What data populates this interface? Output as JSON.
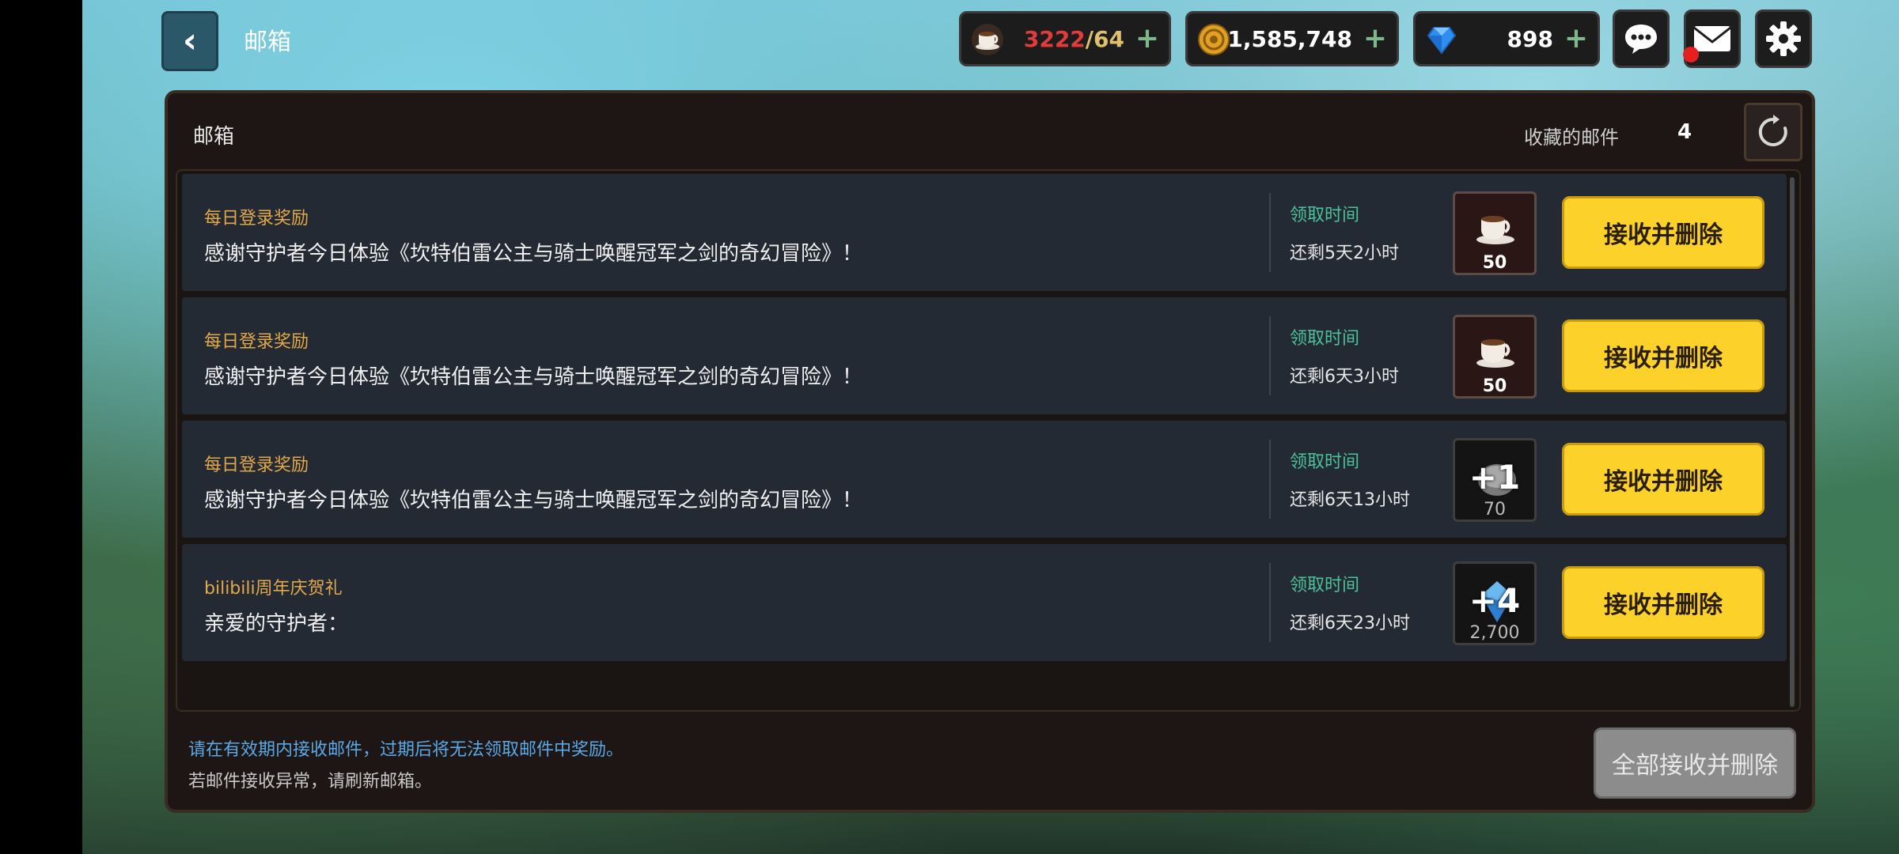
{
  "header": {
    "title": "邮箱",
    "resources": {
      "stamina": {
        "current": "3222",
        "max": "/64",
        "icon": "coffee-cup-icon"
      },
      "gold": {
        "value": "1,585,748",
        "icon": "gold-coin-icon"
      },
      "gems": {
        "value": "898",
        "icon": "blue-gem-icon"
      }
    },
    "has_unread_mail": true
  },
  "panel": {
    "title": "邮箱",
    "favorites_label": "收藏的邮件",
    "favorites_count": "4"
  },
  "mails": [
    {
      "sender": "每日登录奖励",
      "body": "感谢守护者今日体验《坎特伯雷公主与骑士唤醒冠军之剑的奇幻冒险》！",
      "time_label": "领取时间",
      "time_left": "还剩5天2小时",
      "reward_icon": "coffee-cup-icon",
      "reward_count": "50",
      "claim_label": "接收并删除"
    },
    {
      "sender": "每日登录奖励",
      "body": "感谢守护者今日体验《坎特伯雷公主与骑士唤醒冠军之剑的奇幻冒险》！",
      "time_label": "领取时间",
      "time_left": "还剩6天3小时",
      "reward_icon": "coffee-cup-icon",
      "reward_count": "50",
      "claim_label": "接收并删除"
    },
    {
      "sender": "每日登录奖励",
      "body": "感谢守护者今日体验《坎特伯雷公主与骑士唤醒冠军之剑的奇幻冒险》！",
      "time_label": "领取时间",
      "time_left": "还剩6天13小时",
      "reward_icon": "upgrade-stone-icon",
      "reward_level": "+1",
      "reward_count": "70",
      "claim_label": "接收并删除"
    },
    {
      "sender": "bilibili周年庆贺礼",
      "body": "亲爱的守护者：",
      "time_label": "领取时间",
      "time_left": "还剩6天23小时",
      "reward_icon": "crystal-hammer-icon",
      "reward_level": "+4",
      "reward_count": "2,700",
      "claim_label": "接收并删除"
    }
  ],
  "footer": {
    "notice_primary": "请在有效期内接收邮件，过期后将无法领取邮件中奖励。",
    "notice_secondary": "若邮件接收异常，请刷新邮箱。",
    "claim_all_label": "全部接收并删除"
  },
  "colors": {
    "accent_yellow": "#fcd22a",
    "stamina_red": "#e23b3b",
    "time_label_green": "#4cc29a",
    "sender_orange": "#e2a84a",
    "notice_blue": "#5aa9e6"
  }
}
